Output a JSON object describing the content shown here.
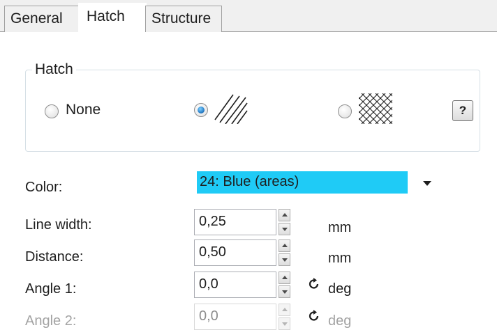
{
  "tabs": [
    {
      "label": "General",
      "active": false
    },
    {
      "label": "Hatch",
      "active": true
    },
    {
      "label": "Structure",
      "active": false
    }
  ],
  "hatch_group": {
    "legend": "Hatch",
    "options": [
      {
        "label": "None",
        "icon": "none",
        "selected": false
      },
      {
        "label": "",
        "icon": "diagonal-lines-pattern",
        "selected": true
      },
      {
        "label": "",
        "icon": "crosshatch-pattern",
        "selected": false
      }
    ],
    "help_label": "?"
  },
  "fields": {
    "color": {
      "label": "Color:",
      "value": "24: Blue (areas)",
      "highlight": "#1fcbf6"
    },
    "line_width": {
      "label": "Line width:",
      "value": "0,25",
      "unit": "mm"
    },
    "distance": {
      "label": "Distance:",
      "value": "0,50",
      "unit": "mm"
    },
    "angle1": {
      "label": "Angle 1:",
      "value": "0,0",
      "unit": "deg",
      "icon": "rotate-icon"
    },
    "angle2": {
      "label": "Angle 2:",
      "value": "0,0",
      "unit": "deg",
      "icon": "rotate-icon",
      "disabled": true
    }
  }
}
